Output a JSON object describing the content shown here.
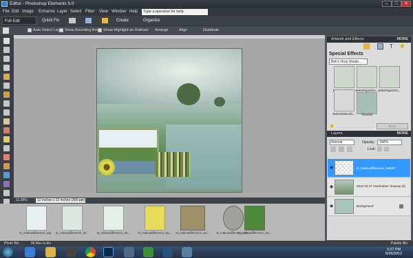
{
  "window": {
    "title": "Editor - Photoshop Elements 5.0",
    "min": "–",
    "max": "□",
    "close": "✕"
  },
  "menu": [
    "File",
    "Edit",
    "Image",
    "Enhance",
    "Layer",
    "Select",
    "Filter",
    "View",
    "Window",
    "Help"
  ],
  "help_placeholder": "Type a question for help",
  "modes": {
    "full_edit": "Full Edit",
    "quick_fix": "Quick Fix",
    "create": "Create",
    "organize": "Organize"
  },
  "options": {
    "auto_select": "Auto Select Layer",
    "bounding": "Show Bounding Box",
    "highlight": "Show Highlight on Rollover",
    "arrange": "Arrange",
    "align": "Align",
    "distribute": "Distribute"
  },
  "status": {
    "zoom": "11.58%",
    "size": "12 inches x 12 inches (300 ppi)"
  },
  "bin": {
    "items": [
      {
        "label": "ts_makeadifference_tag...",
        "color": "#e9eef0"
      },
      {
        "label": "ts_makeadifference_tre...",
        "color": "#dfe7e2"
      },
      {
        "label": "ts_makeadifference_tre...",
        "color": "#e4ede6"
      },
      {
        "label": "ts_makeadifference_wo...",
        "color": "#e6dc5a"
      },
      {
        "label": "ts_makeadifference_wo...",
        "color": "#9b9068"
      },
      {
        "label": "ts_makeadifference_wo...",
        "color": "#a0a19a"
      },
      {
        "label": "ts_makeadifference_wo...",
        "color": "#4e8a3a"
      }
    ],
    "photo_bin": "Photo Bin",
    "count": "86 files in bin",
    "palette_bin": "Palette Bin"
  },
  "artwork": {
    "header": "Artwork and Effects",
    "more": "MORE",
    "title": "Special Effects",
    "selected": "Bek's Drop Shado...",
    "items": [
      "BeksMaskingT...",
      "BeksPaperDro...",
      "BeksPaperDro...",
      "BeksStickerSh...",
      "Thumbs"
    ],
    "apply": "Apply"
  },
  "layers": {
    "header": "Layers",
    "more": "MORE",
    "blend": "Normal",
    "opacity_label": "Opacity:",
    "opacity": "100%",
    "lock_label": "Lock:",
    "items": [
      {
        "name": "ts_makeadifference_swbl07",
        "selected": true
      },
      {
        "name": "2012 04 27 Overholser cleanup (2)",
        "selected": false
      },
      {
        "name": "Background",
        "selected": false
      }
    ]
  },
  "clock": {
    "time": "3:27 PM",
    "date": "5/26/2012"
  },
  "colors": {
    "accent": "#3399ff",
    "taskbar": "#2a3c57"
  }
}
